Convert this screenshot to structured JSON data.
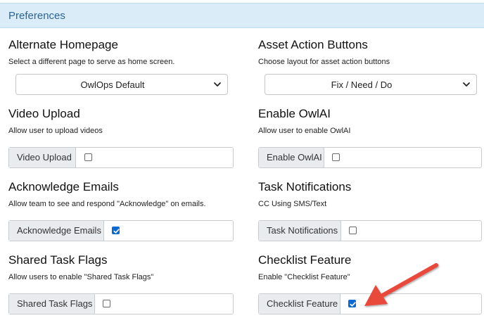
{
  "panel": {
    "title": "Preferences"
  },
  "alternate_homepage": {
    "title": "Alternate Homepage",
    "description": "Select a different page to serve as home screen.",
    "selected": "OwlOps Default"
  },
  "asset_action_buttons": {
    "title": "Asset Action Buttons",
    "description": "Choose layout for asset action buttons",
    "selected": "Fix / Need / Do"
  },
  "video_upload": {
    "title": "Video Upload",
    "description": "Allow user to upload videos",
    "label": "Video Upload",
    "checked": false
  },
  "enable_owlai": {
    "title": "Enable OwlAI",
    "description": "Allow user to enable OwlAI",
    "label": "Enable OwlAI",
    "checked": false
  },
  "acknowledge_emails": {
    "title": "Acknowledge Emails",
    "description": "Allow team to see and respond \"Acknowledge\" on emails.",
    "label": "Acknowledge Emails",
    "checked": true
  },
  "task_notifications": {
    "title": "Task Notifications",
    "description": "CC Using SMS/Text",
    "label": "Task Notifications",
    "checked": false
  },
  "shared_task_flags": {
    "title": "Shared Task Flags",
    "description": "Allow users to enable \"Shared Task Flags\"",
    "label": "Shared Task Flags",
    "checked": false
  },
  "checklist_feature": {
    "title": "Checklist Feature",
    "description": "Enable \"Checklist Feature\"",
    "label": "Checklist Feature",
    "checked": true
  },
  "annotation": {
    "arrow_color": "#e8483b",
    "checkbox_color": "#0b6ad1",
    "header_color": "#d9ecf7"
  }
}
